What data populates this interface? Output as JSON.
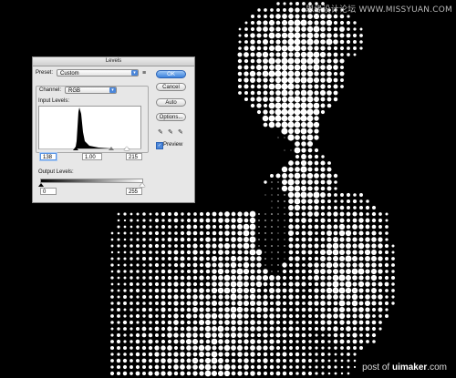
{
  "watermark_top": "思缘设计论坛 WWW.MISSYUAN.COM",
  "watermark_bottom": {
    "prefix": "post of ",
    "brand": "uimaker",
    "suffix": ".com"
  },
  "dialog": {
    "title": "Levels",
    "preset_label": "Preset:",
    "preset_value": "Custom",
    "channel_label": "Channel:",
    "channel_value": "RGB",
    "input_levels_label": "Input Levels:",
    "input_black": "138",
    "input_gamma": "1.00",
    "input_white": "215",
    "output_levels_label": "Output Levels:",
    "output_black": "0",
    "output_white": "255",
    "preview_label": "Preview",
    "preview_checked": true,
    "buttons": {
      "ok": "OK",
      "cancel": "Cancel",
      "auto": "Auto",
      "options": "Options..."
    }
  },
  "colors": {
    "accent": "#3b82dd",
    "canvas": "#000000"
  }
}
